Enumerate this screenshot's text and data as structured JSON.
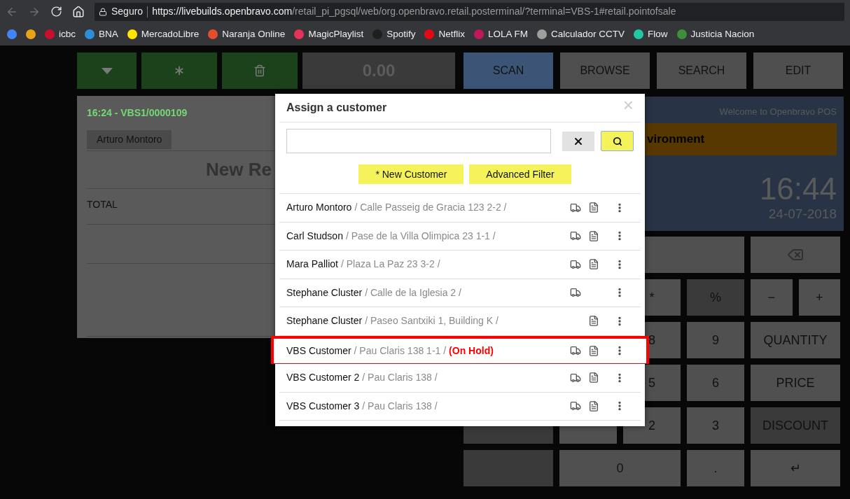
{
  "browser": {
    "security_label": "Seguro",
    "url_host": "https://livebuilds.openbravo.com",
    "url_path": "/retail_pi_pgsql/web/org.openbravo.retail.posterminal/?terminal=VBS-1#retail.pointofsale"
  },
  "bookmarks": [
    {
      "color": "#4285f4"
    },
    {
      "color": "#e8a317"
    },
    {
      "label": "icbc",
      "color": "#c8102e"
    },
    {
      "label": "BNA",
      "color": "#2b8fd6"
    },
    {
      "label": "MercadoLibre",
      "color": "#ffe600"
    },
    {
      "label": "Naranja Online",
      "color": "#e54d2e"
    },
    {
      "label": "MagicPlaylist",
      "color": "#e5325a"
    },
    {
      "label": "Spotify",
      "color": "#1f1f1f"
    },
    {
      "label": "Netflix",
      "color": "#e50914"
    },
    {
      "label": "LOLA FM",
      "color": "#c2185b"
    },
    {
      "label": "Calculador CCTV",
      "color": "#9e9e9e"
    },
    {
      "label": "Flow",
      "color": "#1fc7a6"
    },
    {
      "label": "Justicia Nacion",
      "color": "#3f8f3a"
    }
  ],
  "toolbar": {
    "total": "0.00",
    "nav_buttons": [
      {
        "label": "SCAN",
        "selected": true
      },
      {
        "label": "BROWSE",
        "selected": false
      },
      {
        "label": "SEARCH",
        "selected": false
      },
      {
        "label": "EDIT",
        "selected": false
      }
    ]
  },
  "receipt": {
    "header": "16:24 - VBS1/0000109",
    "customer": "Arturo Montoro",
    "title": "New Re",
    "total_label": "TOTAL"
  },
  "info_panel": {
    "welcome": "Welcome to Openbravo POS",
    "banner": "vironment",
    "time": "16:44",
    "date": "24-07-2018"
  },
  "keypad": [
    {
      "label": "*",
      "dark": false
    },
    {
      "label": "%",
      "dark": true
    },
    {
      "label": "−",
      "dark": false
    },
    {
      "label": "+",
      "dark": false
    },
    {
      "label": "8",
      "dark": false
    },
    {
      "label": "9",
      "dark": false
    },
    {
      "label": "QUANTITY",
      "dark": false
    },
    {
      "label": "5",
      "dark": false
    },
    {
      "label": "6",
      "dark": false
    },
    {
      "label": "PRICE",
      "dark": false
    },
    {
      "label": "2",
      "dark": false
    },
    {
      "label": "3",
      "dark": false
    },
    {
      "label": "DISCOUNT",
      "dark": true
    },
    {
      "label": "0",
      "dark": false
    },
    {
      "label": ".",
      "dark": false
    },
    {
      "label": "↵",
      "dark": false
    }
  ],
  "dialog": {
    "title": "Assign a customer",
    "close": "×",
    "buttons": [
      "* New Customer",
      "Advanced Filter"
    ],
    "customers": [
      {
        "name": "Arturo Montoro",
        "address": "/ Calle Passeig de Gracia 123 2-2 /",
        "shipping": true,
        "invoicing": true,
        "highlighted": false
      },
      {
        "name": "Carl Studson",
        "address": "/ Pase de la Villa Olimpica 23 1-1 /",
        "shipping": true,
        "invoicing": true,
        "highlighted": false
      },
      {
        "name": "Mara Palliot",
        "address": "/ Plaza La Paz 23 3-2 /",
        "shipping": true,
        "invoicing": true,
        "highlighted": false
      },
      {
        "name": "Stephane Cluster",
        "address": "/ Calle de la Iglesia 2 /",
        "shipping": true,
        "invoicing": false,
        "highlighted": false
      },
      {
        "name": "Stephane Cluster",
        "address": "/ Paseo Santxiki 1, Building K /",
        "shipping": false,
        "invoicing": true,
        "highlighted": false
      },
      {
        "name": "VBS Customer",
        "address": "/ Pau Claris 138 1-1 /",
        "status": "(On Hold)",
        "shipping": true,
        "invoicing": true,
        "highlighted": true
      },
      {
        "name": "VBS Customer 2",
        "address": "/ Pau Claris 138 /",
        "shipping": true,
        "invoicing": true,
        "highlighted": false
      },
      {
        "name": "VBS Customer 3",
        "address": "/ Pau Claris 138 /",
        "shipping": true,
        "invoicing": true,
        "highlighted": false
      }
    ]
  }
}
